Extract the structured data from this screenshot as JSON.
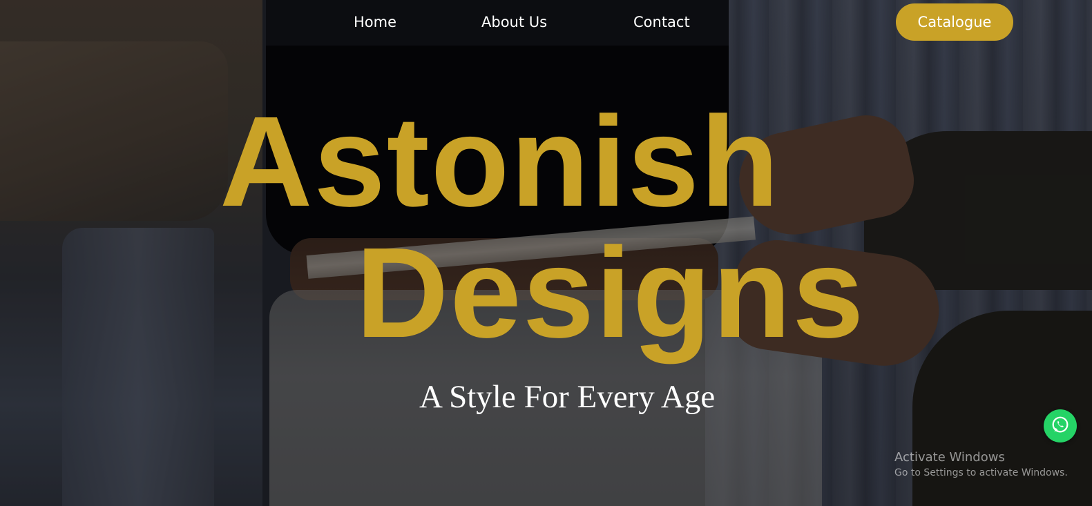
{
  "nav": {
    "home_label": "Home",
    "about_label": "About Us",
    "contact_label": "Contact",
    "catalogue_label": "Catalogue"
  },
  "hero": {
    "line1": "Astonish",
    "line2": "Designs",
    "tagline": "A Style For Every Age",
    "background": "tailor measuring waist with measuring tape"
  },
  "whatsapp": {
    "icon": "whatsapp-icon"
  },
  "watermark": {
    "title": "Activate Windows",
    "subtitle": "Go to Settings to activate Windows."
  },
  "colors": {
    "accent": "#c9a227",
    "text_light": "#ffffff",
    "whatsapp_green": "#25d366"
  }
}
